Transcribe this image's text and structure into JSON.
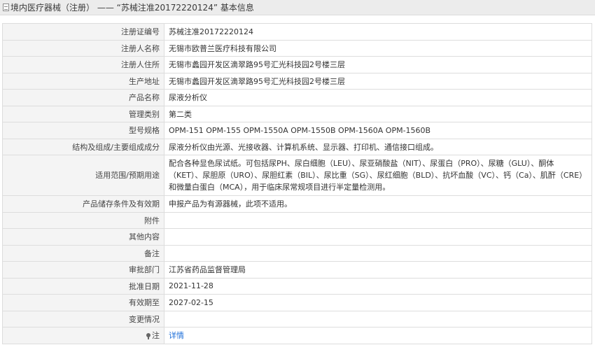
{
  "header": {
    "icon": "document-icon",
    "title": "境内医疗器械（注册） —— “苏械注准20172220124” 基本信息"
  },
  "rows": [
    {
      "label": "注册证编号",
      "value": "苏械注准20172220124"
    },
    {
      "label": "注册人名称",
      "value": "无锡市欧普兰医疗科技有限公司"
    },
    {
      "label": "注册人住所",
      "value": "无锡市蠡园开发区滴翠路95号汇光科技园2号楼三层"
    },
    {
      "label": "生产地址",
      "value": "无锡市蠡园开发区滴翠路95号汇光科技园2号楼三层"
    },
    {
      "label": "产品名称",
      "value": "尿液分析仪"
    },
    {
      "label": "管理类别",
      "value": "第二类"
    },
    {
      "label": "型号规格",
      "value": "OPM-151 OPM-155 OPM-1550A OPM-1550B OPM-1560A OPM-1560B"
    },
    {
      "label": "结构及组成/主要组成成分",
      "value": "尿液分析仪由光源、光接收器、计算机系统、显示器、打印机、通信接口组成。"
    },
    {
      "label": "适用范围/预期用途",
      "value": "配合各种显色尿试纸。可包括尿PH、尿白细胞（LEU）、尿亚硝酸盐（NIT）、尿蛋白（PRO）、尿糖（GLU）、酮体（KET）、尿胆原（URO）、尿胆红素（BIL）、尿比重（SG）、尿红细胞（BLD）、抗坏血酸（VC）、钙（Ca）、肌酐（CRE）和微量白蛋白（MCA），用于临床尿常规项目进行半定量检测用。"
    },
    {
      "label": "产品储存条件及有效期",
      "value": "申报产品为有源器械，此项不适用。"
    },
    {
      "label": "附件",
      "value": ""
    },
    {
      "label": "其他内容",
      "value": ""
    },
    {
      "label": "备注",
      "value": ""
    },
    {
      "label": "审批部门",
      "value": "江苏省药品监督管理局"
    },
    {
      "label": "批准日期",
      "value": "2021-11-28"
    },
    {
      "label": "有效期至",
      "value": "2027-02-15"
    },
    {
      "label": "变更情况",
      "value": ""
    }
  ],
  "note_row": {
    "icon": "pin-icon",
    "label": "注",
    "link": "详情"
  },
  "colors": {
    "link": "#1e6fd9",
    "label_bg": "#f4f4f4",
    "border": "#dddddd"
  }
}
